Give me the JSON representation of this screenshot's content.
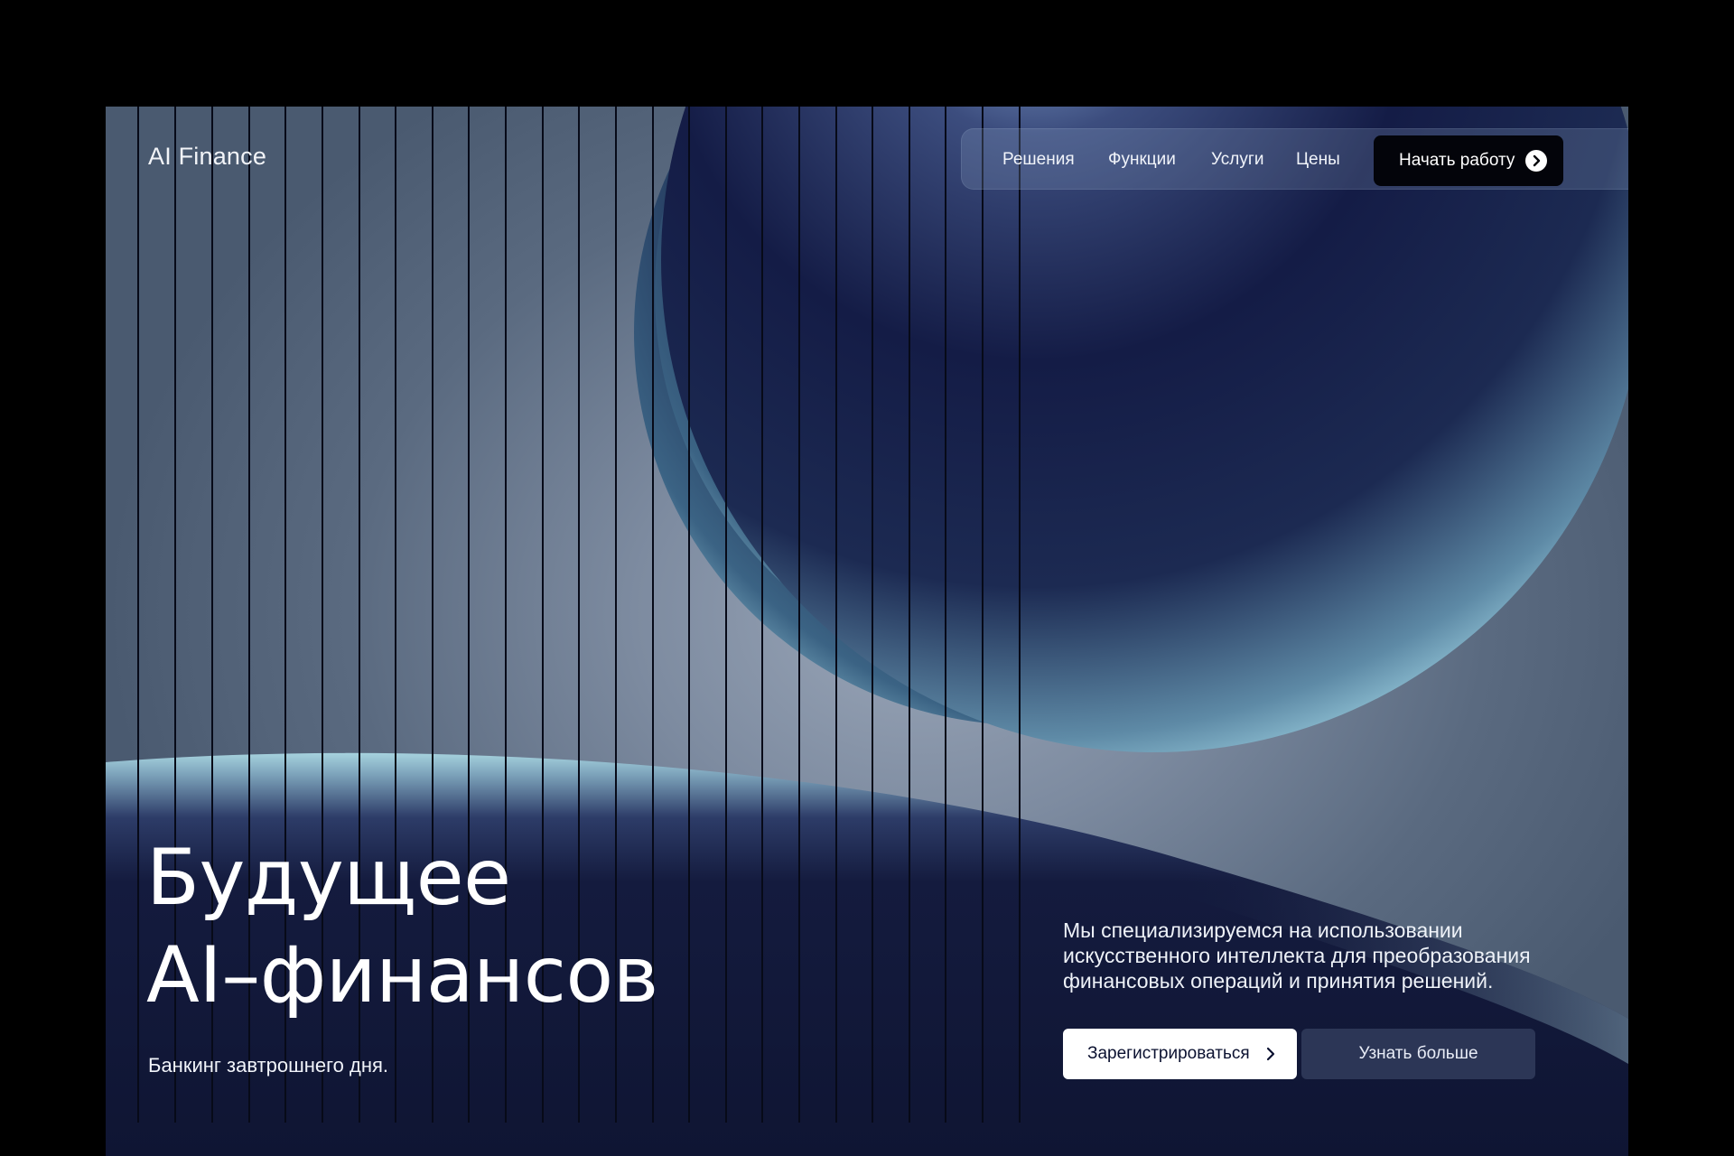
{
  "brand": {
    "name": "AI Finance"
  },
  "nav": {
    "links": [
      {
        "label": "Решения"
      },
      {
        "label": "Функции"
      },
      {
        "label": "Услуги"
      },
      {
        "label": "Цены"
      }
    ],
    "cta_label": "Начать работу",
    "cta_icon": "arrow-right-circle-icon"
  },
  "hero": {
    "headline_line1": "Будущее",
    "headline_line2": "AI–финансов",
    "tagline": "Банкинг завтрошнего дня.",
    "description": "Мы специализируемся на использовании искусственного интеллекта для преобразования финансовых операций и принятия решений.",
    "primary_button": "Зарегистрироваться",
    "primary_button_icon": "chevron-right-icon",
    "secondary_button": "Узнать больше"
  },
  "colors": {
    "page_background": "#000000",
    "deep_navy": "#0f1533",
    "sphere_highlight": "#9fd3e4",
    "cta_background": "#03040a",
    "secondary_button": "#2c3656"
  }
}
